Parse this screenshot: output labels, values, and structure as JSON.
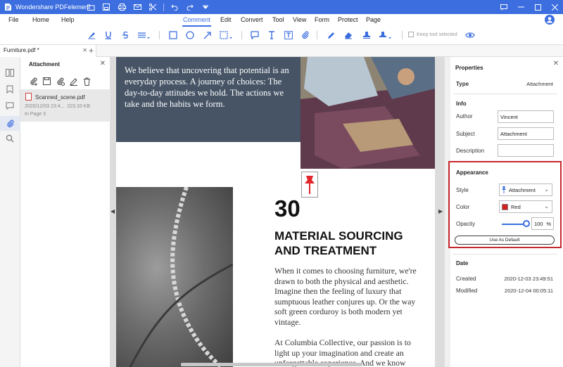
{
  "app": {
    "title": "Wondershare PDFelement"
  },
  "menu": {
    "items": [
      "File",
      "Home",
      "Help",
      "Comment",
      "Edit",
      "Convert",
      "Tool",
      "View",
      "Form",
      "Protect",
      "Page"
    ],
    "active": "Comment"
  },
  "toolbar": {
    "keep_tool_label": "Keep tool selected"
  },
  "tabs": {
    "doc_name": "Furniture.pdf *"
  },
  "attachment_panel": {
    "title": "Attachment",
    "item": {
      "name": "Scanned_scene.pdf",
      "date": "2020/12/03 23:4...",
      "size": "223.33 KB",
      "page": "In Page 3"
    }
  },
  "document": {
    "quote": "We believe that uncovering that potential is an everyday process. A journey of choices: The day-to-day attitudes we hold. The actions we take and the habits we form.",
    "number": "30",
    "heading": "MATERIAL SOURCING AND TREATMENT",
    "body1": "When it comes to choosing furniture, we're drawn to both the physical and aesthetic. Imagine then the feeling of luxury that sumptuous leather conjures up. Or the way soft green corduroy is both modern yet vintage.",
    "body2": "At Columbia Collective, our passion is to light up your imagination and create an unforgettable experience. And we know"
  },
  "properties": {
    "title": "Properties",
    "type_label": "Type",
    "type_value": "Attachment",
    "info_label": "Info",
    "author_label": "Author",
    "author_value": "Vincent",
    "subject_label": "Subject",
    "subject_value": "Attachment",
    "description_label": "Description",
    "description_value": "",
    "appearance_label": "Appearance",
    "style_label": "Style",
    "style_value": "Attachment",
    "color_label": "Color",
    "color_value": "Red",
    "opacity_label": "Opacity",
    "opacity_value": "100",
    "opacity_unit": "%",
    "default_button": "Use As Default",
    "date_label": "Date",
    "created_label": "Created",
    "created_value": "2020-12-03 23:49:51",
    "modified_label": "Modified",
    "modified_value": "2020-12-04 00:05:11"
  },
  "colors": {
    "accent": "#3c6ee0",
    "highlight_border": "#c6282e",
    "swatch_red": "#d42020"
  }
}
